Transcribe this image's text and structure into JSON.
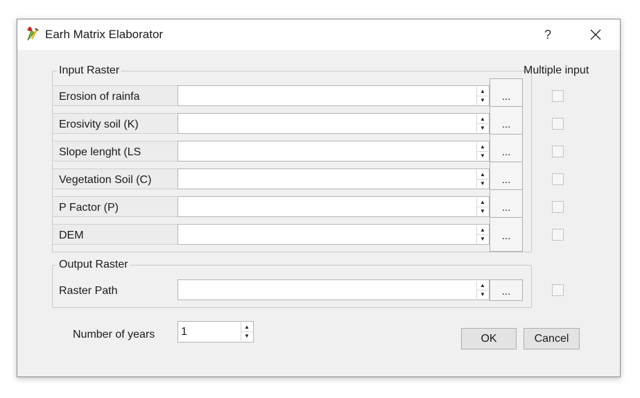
{
  "window": {
    "title": "Earh Matrix Elaborator",
    "help_glyph": "?",
    "app_icon": "qgis-plugin-icon",
    "close_icon": "close-icon"
  },
  "input_group": {
    "title": "Input Raster",
    "multiple_input_label": "Multiple input",
    "rows": [
      {
        "label": "Erosion of rainfa",
        "value": "",
        "browse": "...",
        "multiple_checked": false
      },
      {
        "label": "Erosivity soil (K)",
        "value": "",
        "browse": "...",
        "multiple_checked": false
      },
      {
        "label": "Slope lenght (LS",
        "value": "",
        "browse": "...",
        "multiple_checked": false
      },
      {
        "label": "Vegetation Soil (C)",
        "value": "",
        "browse": "...",
        "multiple_checked": false
      },
      {
        "label": "P Factor (P)",
        "value": "",
        "browse": "...",
        "multiple_checked": false
      },
      {
        "label": "DEM",
        "value": "",
        "browse": "...",
        "multiple_checked": false
      }
    ]
  },
  "output_group": {
    "title": "Output Raster",
    "row": {
      "label": "Raster Path",
      "value": "",
      "browse": "...",
      "checked": false
    }
  },
  "years": {
    "label": "Number of years",
    "value": "1"
  },
  "buttons": {
    "ok": "OK",
    "cancel": "Cancel"
  },
  "colors": {
    "dialog_bg": "#f0f0f0",
    "titlebar_bg": "#ffffff",
    "field_bg": "#ffffff",
    "border": "#adadad"
  }
}
